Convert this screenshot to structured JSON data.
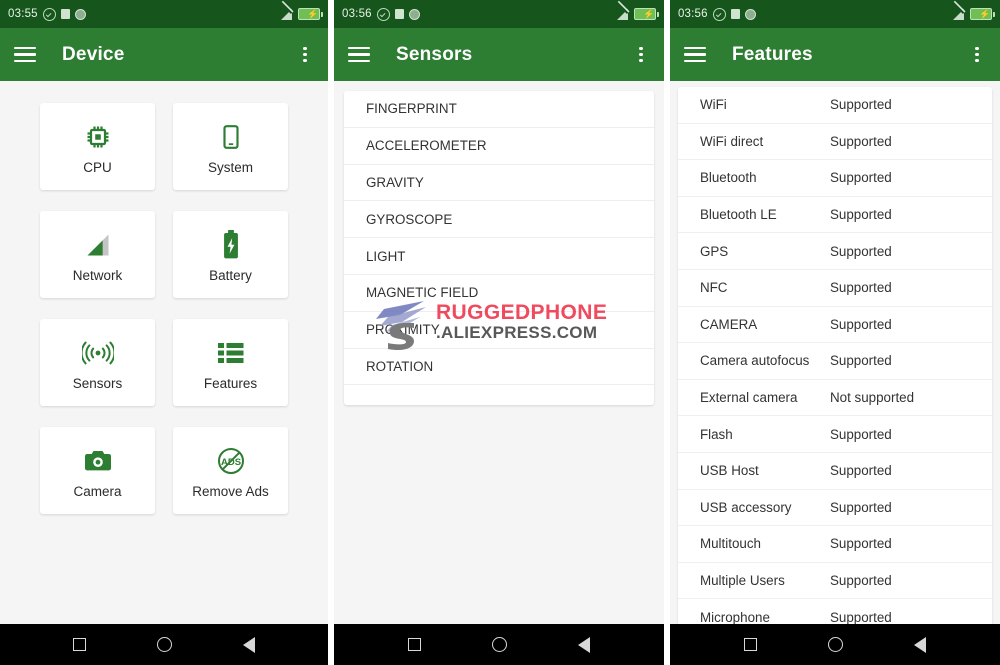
{
  "panels": [
    {
      "statusbar": {
        "time": "03:55",
        "icons": [
          "check-circle-icon",
          "square-icon",
          "circle-icon",
          "signal-off-icon",
          "battery-charging-icon"
        ]
      },
      "appbar": {
        "title": "Device",
        "menu_icon": "hamburger-icon",
        "overflow_icon": "kebab-menu-icon"
      },
      "grid": [
        {
          "label": "CPU",
          "icon": "cpu-chip-icon"
        },
        {
          "label": "System",
          "icon": "smartphone-icon"
        },
        {
          "label": "Network",
          "icon": "signal-bars-icon"
        },
        {
          "label": "Battery",
          "icon": "battery-icon"
        },
        {
          "label": "Sensors",
          "icon": "radio-waves-icon"
        },
        {
          "label": "Features",
          "icon": "list-icon"
        },
        {
          "label": "Camera",
          "icon": "camera-icon"
        },
        {
          "label": "Remove Ads",
          "icon": "no-ads-icon"
        }
      ]
    },
    {
      "statusbar": {
        "time": "03:56",
        "icons": [
          "check-circle-icon",
          "square-icon",
          "circle-icon",
          "signal-off-icon",
          "battery-charging-icon"
        ]
      },
      "appbar": {
        "title": "Sensors",
        "menu_icon": "hamburger-icon",
        "overflow_icon": "kebab-menu-icon"
      },
      "sensors": [
        "FINGERPRINT",
        "ACCELEROMETER",
        "GRAVITY",
        "GYROSCOPE",
        "LIGHT",
        "MAGNETIC FIELD",
        "PROXIMITY",
        "ROTATION"
      ],
      "watermark": {
        "line1": "RUGGEDPHONE",
        "line2": ".ALIEXPRESS.COM",
        "color1": "#ef3b52",
        "color2": "#4a4a4a"
      }
    },
    {
      "statusbar": {
        "time": "03:56",
        "icons": [
          "check-circle-icon",
          "square-icon",
          "circle-icon",
          "signal-off-icon",
          "battery-charging-icon"
        ]
      },
      "appbar": {
        "title": "Features",
        "menu_icon": "hamburger-icon",
        "overflow_icon": "kebab-menu-icon"
      },
      "features": [
        {
          "name": "WiFi",
          "value": "Supported"
        },
        {
          "name": "WiFi direct",
          "value": "Supported"
        },
        {
          "name": "Bluetooth",
          "value": "Supported"
        },
        {
          "name": "Bluetooth LE",
          "value": "Supported"
        },
        {
          "name": "GPS",
          "value": "Supported"
        },
        {
          "name": "NFC",
          "value": "Supported"
        },
        {
          "name": "CAMERA",
          "value": "Supported"
        },
        {
          "name": "Camera autofocus",
          "value": "Supported"
        },
        {
          "name": "External camera",
          "value": "Not supported"
        },
        {
          "name": "Flash",
          "value": "Supported"
        },
        {
          "name": "USB Host",
          "value": "Supported"
        },
        {
          "name": "USB accessory",
          "value": "Supported"
        },
        {
          "name": "Multitouch",
          "value": "Supported"
        },
        {
          "name": "Multiple Users",
          "value": "Supported"
        },
        {
          "name": "Microphone",
          "value": "Supported"
        }
      ]
    }
  ],
  "navbar": {
    "recents": "square-recents-icon",
    "home": "circle-home-icon",
    "back": "triangle-back-icon"
  },
  "colors": {
    "statusbar": "#16561c",
    "appbar": "#2d7d32",
    "accent": "#2d7d32",
    "background": "#f5f5f5",
    "card": "#ffffff",
    "navbar": "#000000"
  }
}
